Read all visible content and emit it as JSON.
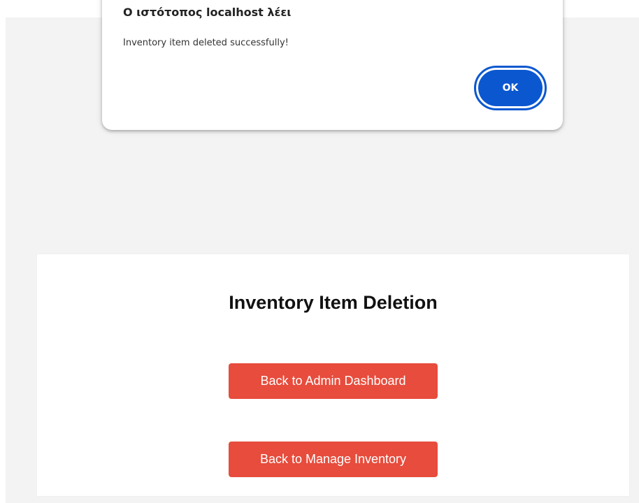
{
  "dialog": {
    "title": "Ο ιστότοπος localhost λέει",
    "message": "Inventory item deleted successfully!",
    "ok_label": "OK"
  },
  "page": {
    "title": "Inventory Item Deletion",
    "buttons": {
      "admin_dashboard": "Back to Admin Dashboard",
      "manage_inventory": "Back to Manage Inventory"
    }
  },
  "colors": {
    "page_background": "#f3f3f3",
    "card_background": "#ffffff",
    "button_red": "#e74c3c",
    "dialog_accent": "#0b57d0"
  }
}
